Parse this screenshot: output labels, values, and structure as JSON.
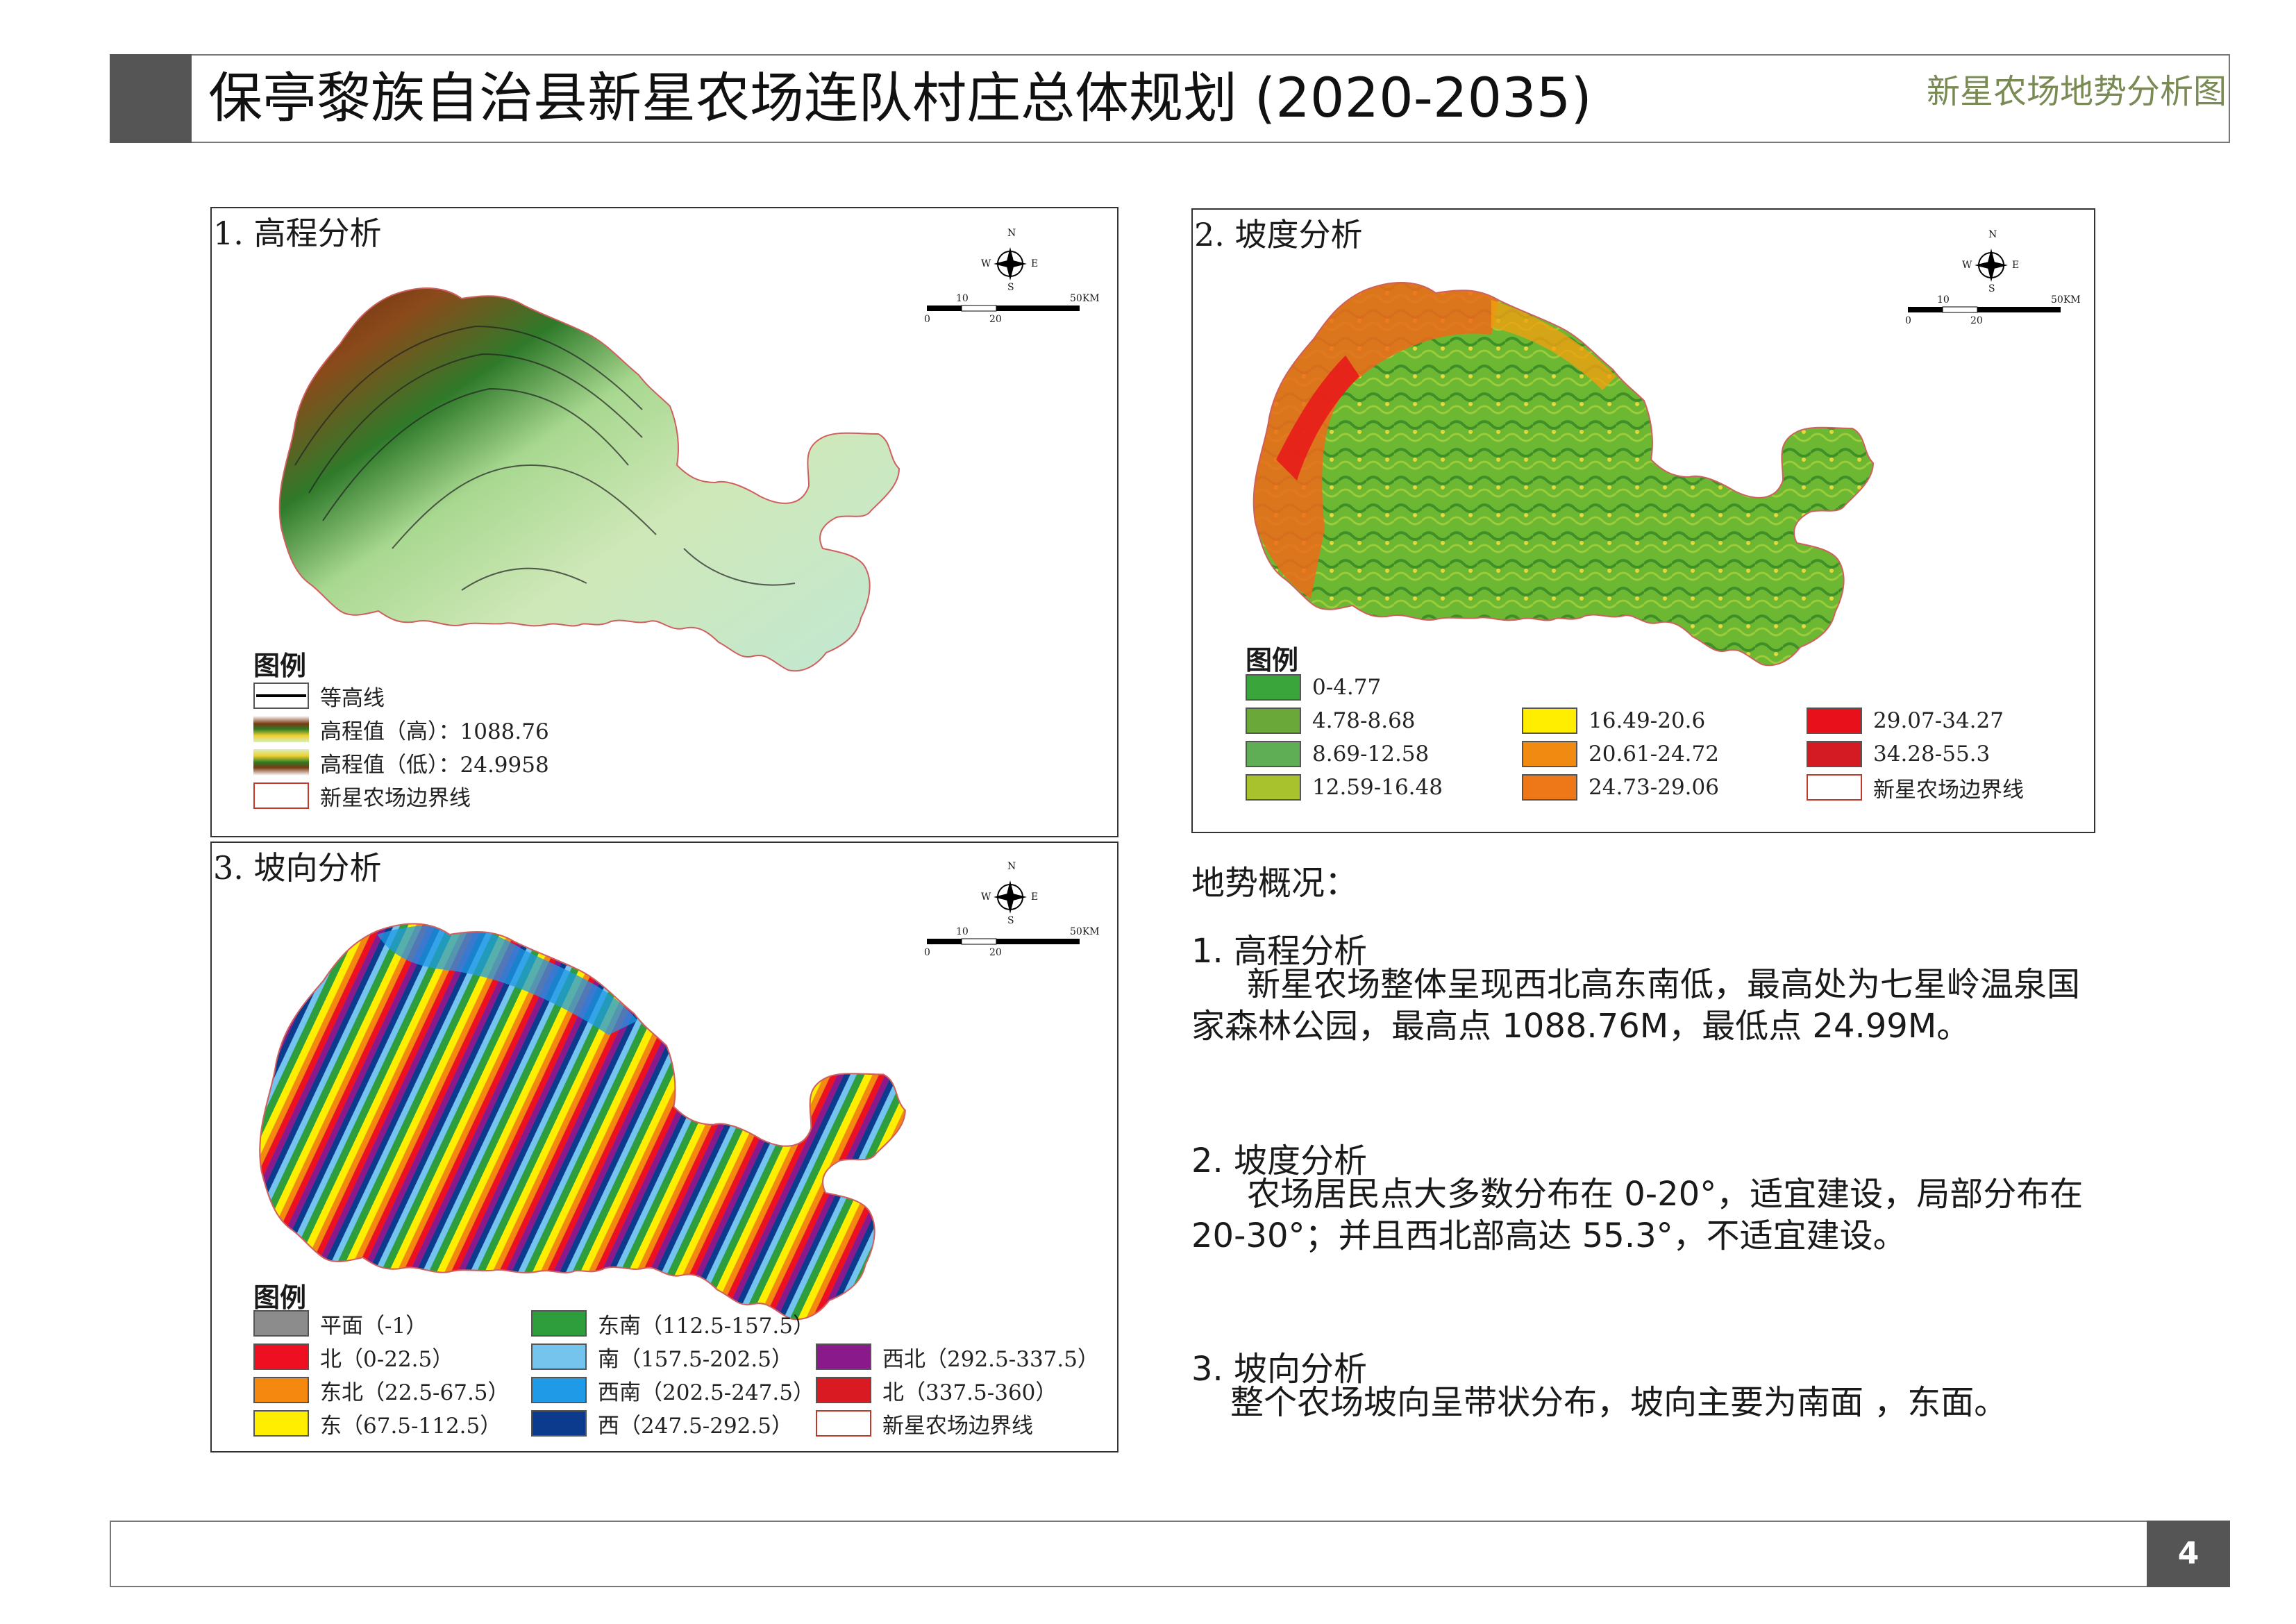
{
  "header": {
    "title": "保亭黎族自治县新星农场连队村庄总体规划 (2020-2035)",
    "subtitle": "新星农场地势分析图"
  },
  "footer": {
    "page_number": "4"
  },
  "compass": {
    "n": "N",
    "s": "S",
    "w": "W",
    "e": "E"
  },
  "scale": {
    "tick_10": "10",
    "tick_50": "50KM",
    "tick_0": "0",
    "tick_20": "20"
  },
  "elevation": {
    "title": "1. 高程分析",
    "legend_title": "图例",
    "legend": [
      {
        "label": "等高线",
        "kind": "contour"
      },
      {
        "label": "高程值（高）：1088.76",
        "kind": "ramp"
      },
      {
        "label": "高程值（低）：24.9958",
        "kind": "ramp"
      },
      {
        "label": "新星农场边界线",
        "kind": "boundary"
      }
    ]
  },
  "slope": {
    "title": "2. 坡度分析",
    "legend_title": "图例",
    "legend": [
      {
        "label": "0-4.77",
        "color": "#3aa53a"
      },
      {
        "label": "4.78-8.68",
        "color": "#6aa83a"
      },
      {
        "label": "8.69-12.58",
        "color": "#5fae55"
      },
      {
        "label": "12.59-16.48",
        "color": "#a8c22e"
      },
      {
        "label": "16.49-20.6",
        "color": "#ffee00"
      },
      {
        "label": "20.61-24.72",
        "color": "#f08a10"
      },
      {
        "label": "24.73-29.06",
        "color": "#ee7718"
      },
      {
        "label": "29.07-34.27",
        "color": "#e8101a"
      },
      {
        "label": "34.28-55.3",
        "color": "#d41a22"
      },
      {
        "label": "新星农场边界线",
        "color": "#ffffff"
      }
    ]
  },
  "aspect": {
    "title": "3. 坡向分析",
    "legend_title": "图例",
    "legend": [
      {
        "label": "平面（-1）",
        "color": "#8c8c8c"
      },
      {
        "label": "北（0-22.5）",
        "color": "#ee1020"
      },
      {
        "label": "东北（22.5-67.5）",
        "color": "#f5880f"
      },
      {
        "label": "东（67.5-112.5）",
        "color": "#ffee00"
      },
      {
        "label": "东南（112.5-157.5）",
        "color": "#2e9e3c"
      },
      {
        "label": "南（157.5-202.5）",
        "color": "#74c4ee"
      },
      {
        "label": "西南（202.5-247.5）",
        "color": "#1f9ae6"
      },
      {
        "label": "西（247.5-292.5）",
        "color": "#0c3a8c"
      },
      {
        "label": "西北（292.5-337.5）",
        "color": "#8a1a8c"
      },
      {
        "label": "北（337.5-360）",
        "color": "#d91a22"
      },
      {
        "label": "新星农场边界线",
        "color": "#ffffff"
      }
    ]
  },
  "summary": {
    "heading": "地势概况：",
    "sections": [
      {
        "title": "1. 高程分析",
        "body": "新星农场整体呈现西北高东南低，最高处为七星岭温泉国家森林公园，最高点 1088.76M，最低点 24.99M。"
      },
      {
        "title": "2. 坡度分析",
        "body": "农场居民点大多数分布在 0-20°，适宜建设，局部分布在 20-30°；并且西北部高达 55.3°，不适宜建设。"
      },
      {
        "title": "3. 坡向分析",
        "body": "整个农场坡向呈带状分布，坡向主要为南面 ，东面。"
      }
    ]
  }
}
